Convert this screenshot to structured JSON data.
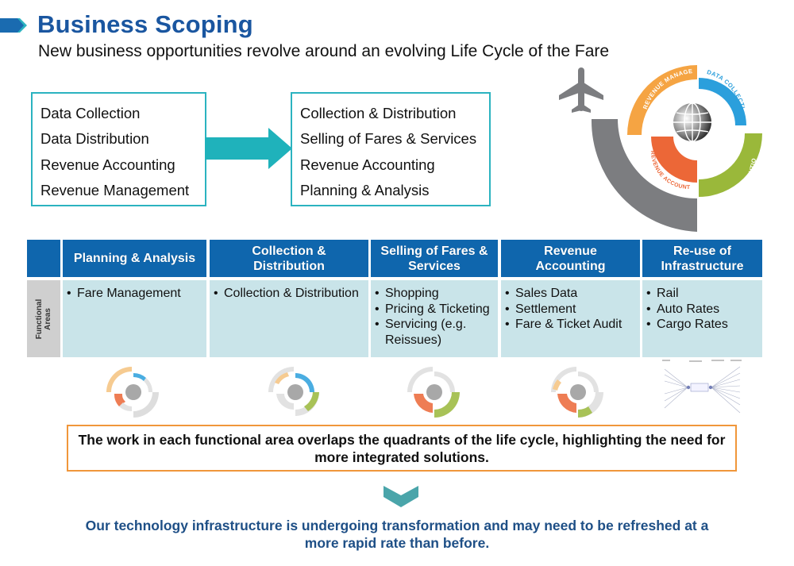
{
  "header": {
    "title": "Business Scoping",
    "subtitle": "New business opportunities revolve around an evolving Life Cycle of the Fare"
  },
  "colors": {
    "title_blue": "#1a56a0",
    "teal": "#2bb3c0",
    "header_blue": "#0f66ad",
    "cell_blue": "#c9e4e9",
    "orange_border": "#f0963a",
    "conclusion_blue": "#1e4f86",
    "revenue_management": "#f5a443",
    "data_collection": "#2b9fdc",
    "data_distribution": "#9ab83a",
    "revenue_accounting": "#ec6737",
    "plane_gray": "#7c7d80"
  },
  "before_box": {
    "items": [
      "Data Collection",
      "Data Distribution",
      "Revenue Accounting",
      "Revenue Management"
    ]
  },
  "after_box": {
    "items": [
      "Collection & Distribution",
      "Selling of Fares & Services",
      "Revenue Accounting",
      "Planning & Analysis"
    ]
  },
  "lifecycle": {
    "segments": [
      "REVENUE MANAGEMENT",
      "DATA COLLECTION",
      "DATA DISTRIBUTION",
      "REVENUE ACCOUNTING"
    ],
    "center_icon": "globe-icon",
    "side_icon": "airplane-icon"
  },
  "table": {
    "row_label_line1": "Functional",
    "row_label_line2": "Areas",
    "columns": [
      {
        "header_line1": "Planning & Analysis",
        "header_line2": "",
        "items": [
          "Fare Management"
        ]
      },
      {
        "header_line1": "Collection &",
        "header_line2": "Distribution",
        "items": [
          "Collection & Distribution"
        ]
      },
      {
        "header_line1": "Selling of Fares &",
        "header_line2": "Services",
        "items": [
          "Shopping",
          "Pricing & Ticketing",
          "Servicing (e.g.",
          "Reissues)"
        ]
      },
      {
        "header_line1": "Revenue",
        "header_line2": "Accounting",
        "items": [
          "Sales Data",
          "Settlement",
          "Fare & Ticket Audit"
        ]
      },
      {
        "header_line1": "Re-use of",
        "header_line2": "Infrastructure",
        "items": [
          "Rail",
          "Auto Rates",
          "Cargo Rates"
        ]
      }
    ]
  },
  "callout": {
    "text": "The work in each functional area overlaps the quadrants of the life cycle, highlighting the need for more integrated solutions."
  },
  "conclusion": {
    "line1": "Our technology infrastructure is undergoing transformation and may need to be refreshed at a",
    "line2": "more rapid rate than before."
  }
}
